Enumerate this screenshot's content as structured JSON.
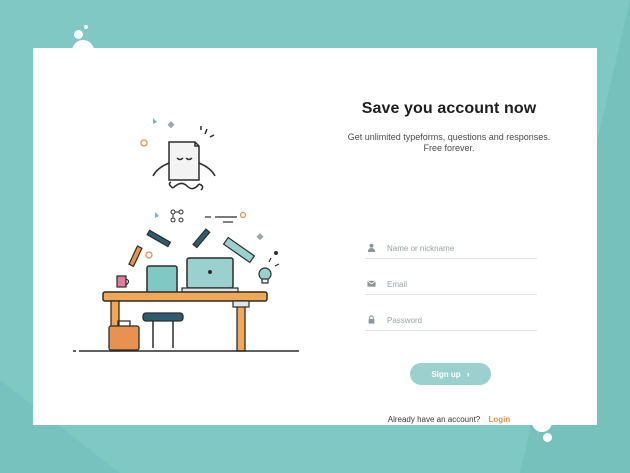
{
  "colors": {
    "background": "#80c8c4",
    "card": "#ffffff",
    "button": "#9ad1cf",
    "link": "#e8924f"
  },
  "signup": {
    "title": "Save you account now",
    "subtitle_line1": "Get unlimited typeforms, questions and responses.",
    "subtitle_line2": "Free forever.",
    "fields": [
      {
        "icon": "user-icon",
        "placeholder": "Name or nickname",
        "value": ""
      },
      {
        "icon": "mail-icon",
        "placeholder": "Email",
        "value": ""
      },
      {
        "icon": "lock-icon",
        "placeholder": "Password",
        "value": ""
      }
    ],
    "button_label": "Sign up",
    "button_icon": "chevron-right-icon",
    "footer_text": "Already have an account?",
    "login_label": "Login"
  }
}
